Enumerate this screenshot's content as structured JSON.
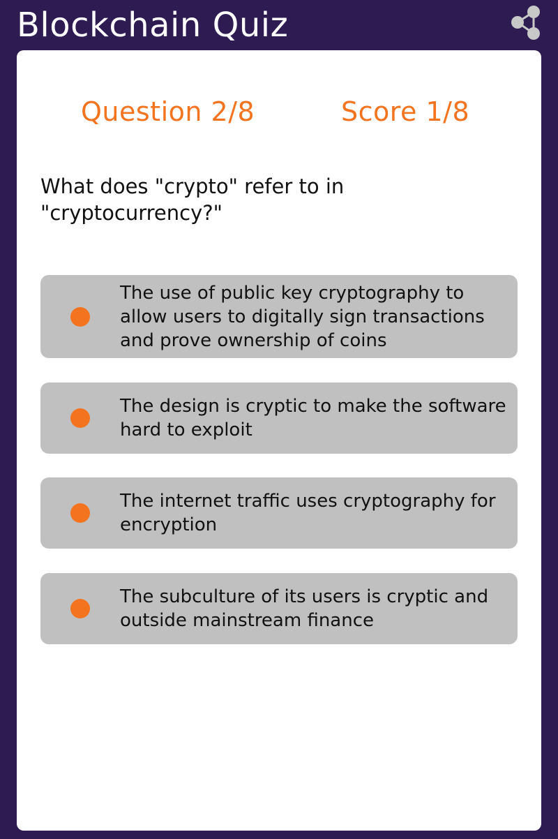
{
  "app": {
    "title": "Blockchain Quiz",
    "share_icon": "share-icon"
  },
  "status": {
    "question_counter": "Question 2/8",
    "score_counter": "Score 1/8"
  },
  "question": {
    "text": "What does \"crypto\" refer to in \"cryptocurrency?\""
  },
  "options": [
    {
      "text": "The use of public key cryptography to allow users to digitally sign transactions and prove ownership of coins"
    },
    {
      "text": "The design is cryptic to make the software hard to exploit"
    },
    {
      "text": "The internet traffic uses cryptography for encryption"
    },
    {
      "text": "The subculture of its users is cryptic and outside mainstream finance"
    }
  ],
  "colors": {
    "header_background": "#2d1b52",
    "accent": "#f4731f",
    "option_background": "#c0c0c0",
    "card_background": "#ffffff"
  }
}
